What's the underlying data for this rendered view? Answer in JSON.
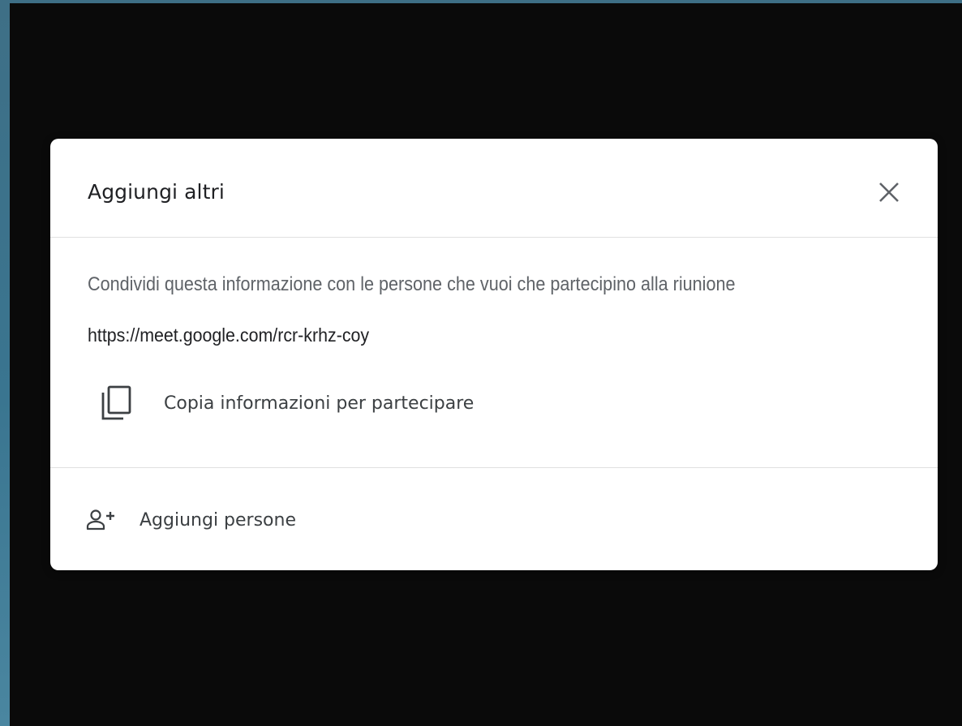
{
  "dialog": {
    "title": "Aggiungi altri",
    "close_icon": "close-icon",
    "info_text": "Condividi questa informazione con le persone che vuoi che partecipino alla riunione",
    "meeting_link": "https://meet.google.com/rcr-krhz-coy",
    "copy_action": {
      "icon": "copy-icon",
      "label": "Copia informazioni per partecipare"
    },
    "add_people_action": {
      "icon": "add-person-icon",
      "label": "Aggiungi persone"
    }
  },
  "colors": {
    "dialog_background": "#ffffff",
    "surface_background": "#0a0a0a",
    "primary_text": "#202124",
    "secondary_text": "#5f6368",
    "divider": "#e0e0e0"
  }
}
